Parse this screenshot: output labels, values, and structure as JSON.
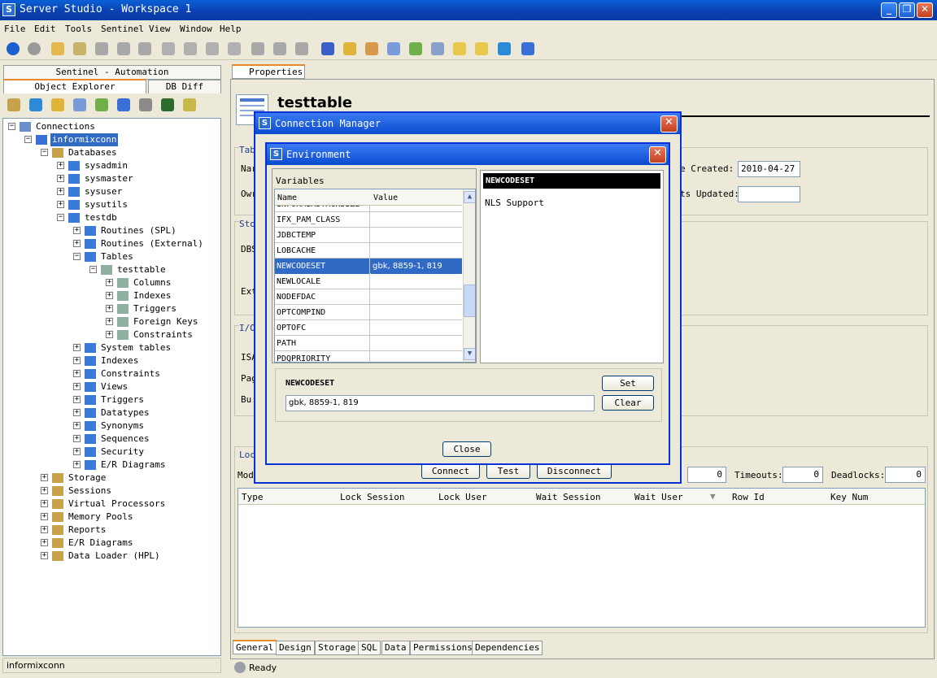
{
  "window": {
    "title": "Server Studio - Workspace 1"
  },
  "menu": [
    "File",
    "Edit",
    "Tools",
    "Sentinel",
    "View",
    "Window",
    "Help"
  ],
  "left": {
    "tabs": {
      "sentinel": "Sentinel - Automation",
      "explorer": "Object Explorer",
      "dbdiff": "DB Diff"
    },
    "tree": [
      {
        "label": "Connections",
        "level": 0
      },
      {
        "label": "informixconn",
        "level": 1
      },
      {
        "label": "Databases",
        "level": 2
      },
      {
        "label": "sysadmin",
        "level": 3
      },
      {
        "label": "sysmaster",
        "level": 3
      },
      {
        "label": "sysuser",
        "level": 3
      },
      {
        "label": "sysutils",
        "level": 3
      },
      {
        "label": "testdb",
        "level": 3
      },
      {
        "label": "Routines (SPL)",
        "level": 4
      },
      {
        "label": "Routines (External)",
        "level": 4
      },
      {
        "label": "Tables",
        "level": 4
      },
      {
        "label": "testtable",
        "level": 5
      },
      {
        "label": "Columns",
        "level": 6
      },
      {
        "label": "Indexes",
        "level": 6
      },
      {
        "label": "Triggers",
        "level": 6
      },
      {
        "label": "Foreign Keys",
        "level": 6
      },
      {
        "label": "Constraints",
        "level": 6
      },
      {
        "label": "System tables",
        "level": 4
      },
      {
        "label": "Indexes",
        "level": 4
      },
      {
        "label": "Constraints",
        "level": 4
      },
      {
        "label": "Views",
        "level": 4
      },
      {
        "label": "Triggers",
        "level": 4
      },
      {
        "label": "Datatypes",
        "level": 4
      },
      {
        "label": "Synonyms",
        "level": 4
      },
      {
        "label": "Sequences",
        "level": 4
      },
      {
        "label": "Security",
        "level": 4
      },
      {
        "label": "E/R Diagrams",
        "level": 4
      },
      {
        "label": "Storage",
        "level": 2
      },
      {
        "label": "Sessions",
        "level": 2
      },
      {
        "label": "Virtual Processors",
        "level": 2
      },
      {
        "label": "Memory Pools",
        "level": 2
      },
      {
        "label": "Reports",
        "level": 2
      },
      {
        "label": "E/R Diagrams",
        "level": 2
      },
      {
        "label": "Data Loader (HPL)",
        "level": 2
      }
    ],
    "status": "informixconn"
  },
  "right": {
    "tab": "Properties",
    "title": "testtable",
    "created_label": "e Created:",
    "created_value": "2010-04-27",
    "stats_label": "ts Updated:",
    "group_labels": [
      "Tab",
      "Sto",
      "I/O",
      "Loc"
    ],
    "row_labels": [
      "Nar",
      "Owr",
      "DBS",
      "Ext",
      "ISA",
      "Pag",
      "Bu:",
      "Mod"
    ],
    "timeouts_label": "Timeouts:",
    "timeouts_value": "0",
    "deadlocks_label": "Deadlocks:",
    "deadlocks_value": "0",
    "first_value": "0",
    "lock_columns": [
      "Type",
      "Lock Session",
      "Lock User",
      "Wait Session",
      "Wait User",
      "Row Id",
      "Key Num"
    ],
    "bottom_tabs": [
      "General",
      "Design",
      "Storage",
      "SQL",
      "Data",
      "Permissions",
      "Dependencies"
    ],
    "status": "Ready"
  },
  "conn_dialog": {
    "title": "Connection Manager",
    "buttons": {
      "connect": "Connect",
      "test": "Test",
      "disconnect": "Disconnect"
    }
  },
  "env_dialog": {
    "title": "Environment",
    "variables_label": "Variables",
    "col_name": "Name",
    "col_value": "Value",
    "rows": [
      {
        "name": "INFORMIXSTACKSIZE",
        "value": ""
      },
      {
        "name": "IFX_PAM_CLASS",
        "value": ""
      },
      {
        "name": "JDBCTEMP",
        "value": ""
      },
      {
        "name": "LOBCACHE",
        "value": ""
      },
      {
        "name": "NEWCODESET",
        "value": "gbk, 8859-1, 819"
      },
      {
        "name": "NEWLOCALE",
        "value": ""
      },
      {
        "name": "NODEFDAC",
        "value": ""
      },
      {
        "name": "OPTCOMPIND",
        "value": ""
      },
      {
        "name": "OPTOFC",
        "value": ""
      },
      {
        "name": "PATH",
        "value": ""
      },
      {
        "name": "PDQPRIORITY",
        "value": ""
      }
    ],
    "desc_title": "NEWCODESET",
    "desc_text": "NLS Support",
    "edit_label": "NEWCODESET",
    "edit_value": "gbk, 8859-1, 819",
    "set_label": "Set",
    "clear_label": "Clear",
    "close_label": "Close"
  }
}
